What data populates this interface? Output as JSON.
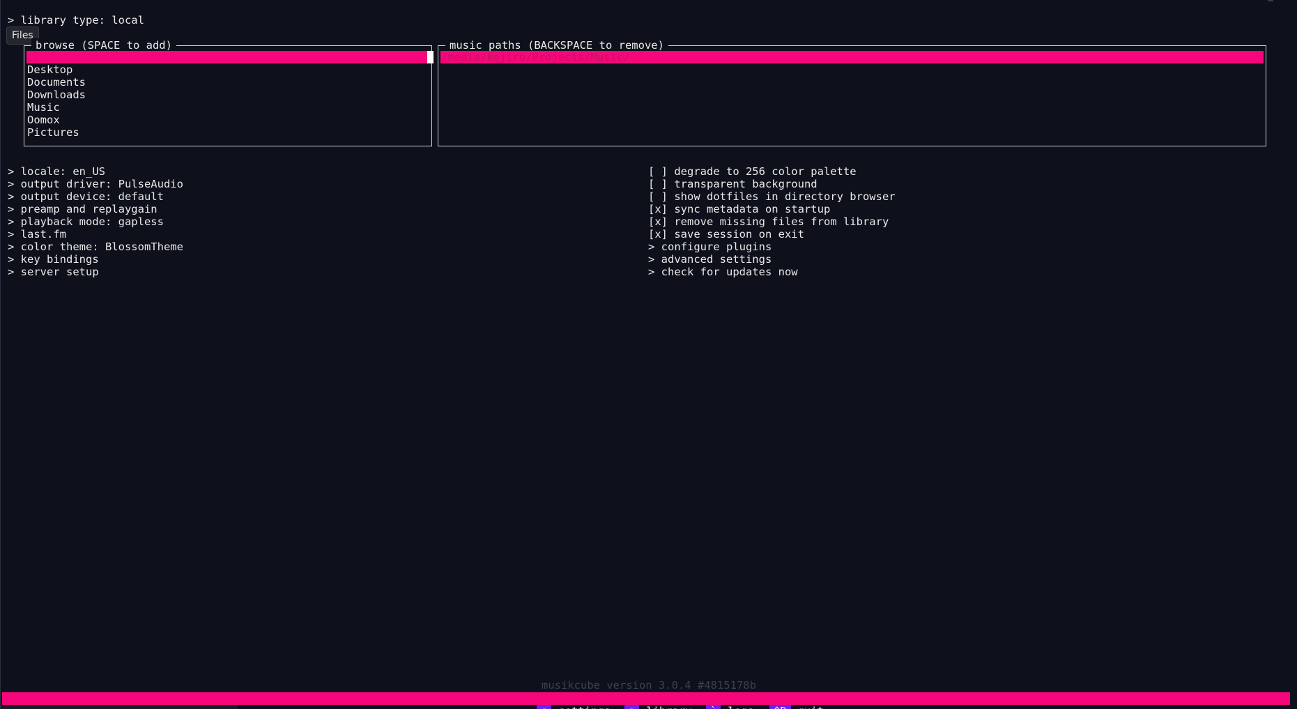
{
  "header": {
    "library_type": "> library type: local"
  },
  "tooltip": {
    "text": "Files"
  },
  "browse_panel": {
    "title": "browse (SPACE to add)",
    "items": [
      {
        "label": ".."
      },
      {
        "label": "Desktop"
      },
      {
        "label": "Documents"
      },
      {
        "label": "Downloads"
      },
      {
        "label": "Music"
      },
      {
        "label": "Oomox"
      },
      {
        "label": "Pictures"
      }
    ]
  },
  "paths_panel": {
    "title": "music paths (BACKSPACE to remove)",
    "items": [
      {
        "label": "/media/kojiro/Projects/Music/"
      }
    ]
  },
  "settings_left": [
    "> locale: en_US",
    "> output driver: PulseAudio",
    "> output device: default",
    "> preamp and replaygain",
    "> playback mode: gapless",
    "> last.fm",
    "> color theme: BlossomTheme",
    "> key bindings",
    "> server setup"
  ],
  "settings_right": [
    "[ ] degrade to 256 color palette",
    "[ ] transparent background",
    "[ ] show dotfiles in directory browser",
    "[x] sync metadata on startup",
    "[x] remove missing files from library",
    "[x] save session on exit",
    "> configure plugins",
    "> advanced settings",
    "> check for updates now"
  ],
  "footer": {
    "version": "musikcube version 3.0.4 #4815178b",
    "shortcuts": [
      {
        "key": "s",
        "label": "settings"
      },
      {
        "key": "a",
        "label": "library"
      },
      {
        "key": "`",
        "label": "logs"
      },
      {
        "key": "^D",
        "label": "quit"
      }
    ]
  },
  "colors": {
    "background": "#0e111b",
    "accent_pink": "#f7067b",
    "key_purple": "#6a22f0",
    "text": "#eaeaea"
  }
}
